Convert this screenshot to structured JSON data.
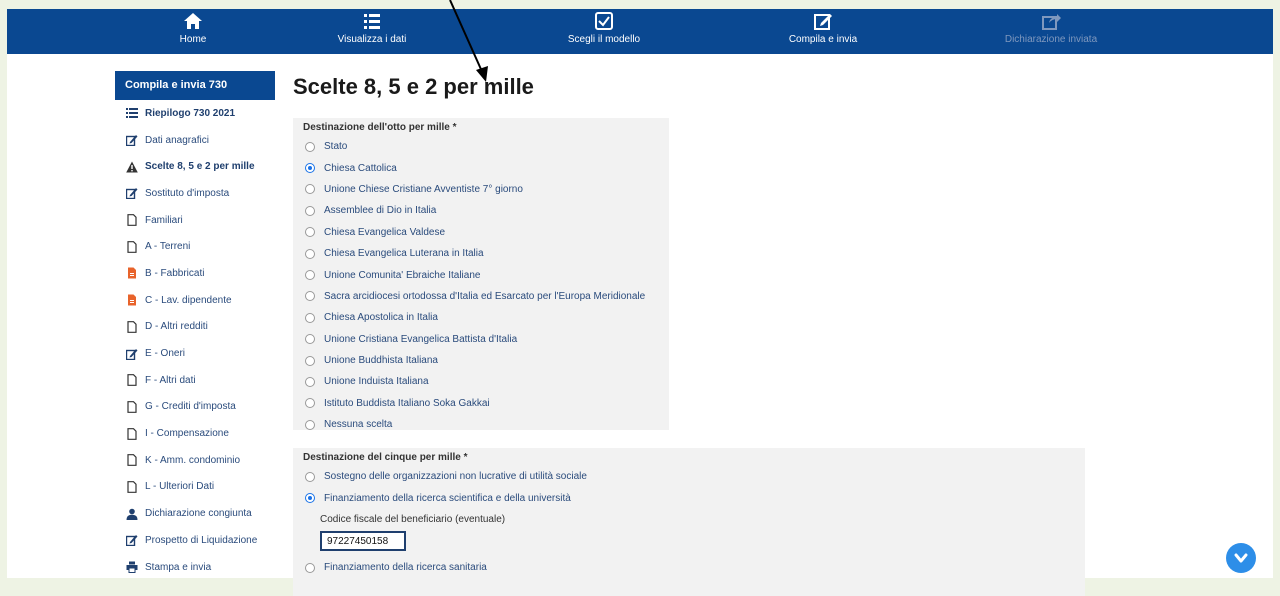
{
  "nav": {
    "items": [
      {
        "label": "Home",
        "icon": "home-icon"
      },
      {
        "label": "Visualizza i dati",
        "icon": "list-icon"
      },
      {
        "label": "Scegli il modello",
        "icon": "checkbox-icon"
      },
      {
        "label": "Compila e invia",
        "icon": "edit-icon"
      },
      {
        "label": "Dichiarazione inviata",
        "icon": "share-icon"
      }
    ]
  },
  "sidebar": {
    "header": "Compila e invia 730",
    "items": [
      {
        "label": "Riepilogo 730 2021",
        "icon": "list-icon"
      },
      {
        "label": "Dati anagrafici",
        "icon": "edit-icon"
      },
      {
        "label": "Scelte 8, 5 e 2 per mille",
        "icon": "warning-icon"
      },
      {
        "label": "Sostituto d'imposta",
        "icon": "edit-icon"
      },
      {
        "label": "Familiari",
        "icon": "file-icon"
      },
      {
        "label": "A - Terreni",
        "icon": "file-icon"
      },
      {
        "label": "B - Fabbricati",
        "icon": "file-orange-icon"
      },
      {
        "label": "C - Lav. dipendente",
        "icon": "file-orange-icon"
      },
      {
        "label": "D - Altri redditi",
        "icon": "file-icon"
      },
      {
        "label": "E - Oneri",
        "icon": "edit-icon"
      },
      {
        "label": "F - Altri dati",
        "icon": "file-icon"
      },
      {
        "label": "G - Crediti d'imposta",
        "icon": "file-icon"
      },
      {
        "label": "I - Compensazione",
        "icon": "file-icon"
      },
      {
        "label": "K - Amm. condominio",
        "icon": "file-icon"
      },
      {
        "label": "L - Ulteriori Dati",
        "icon": "file-icon"
      },
      {
        "label": "Dichiarazione congiunta",
        "icon": "user-icon"
      },
      {
        "label": "Prospetto di Liquidazione",
        "icon": "edit-icon"
      },
      {
        "label": "Stampa e invia",
        "icon": "print-icon"
      }
    ]
  },
  "main": {
    "title": "Scelte 8, 5 e 2 per mille",
    "otto": {
      "legend": "Destinazione dell'otto per mille *",
      "selected": "Chiesa Cattolica",
      "options": [
        "Stato",
        "Chiesa Cattolica",
        "Unione Chiese Cristiane Avventiste 7° giorno",
        "Assemblee di Dio in Italia",
        "Chiesa Evangelica Valdese",
        "Chiesa Evangelica Luterana in Italia",
        "Unione Comunita' Ebraiche Italiane",
        "Sacra arcidiocesi ortodossa d'Italia ed Esarcato per l'Europa Meridionale",
        "Chiesa Apostolica in Italia",
        "Unione Cristiana Evangelica Battista d'Italia",
        "Unione Buddhista Italiana",
        "Unione Induista Italiana",
        "Istituto Buddista Italiano Soka Gakkai",
        "Nessuna scelta"
      ]
    },
    "cinque": {
      "legend": "Destinazione del cinque per mille *",
      "options": [
        "Sostegno delle organizzazioni non lucrative di utilità sociale",
        "Finanziamento della ricerca scientifica e della università",
        "Finanziamento della ricerca sanitaria"
      ],
      "selected": "Finanziamento della ricerca scientifica e della università",
      "cf_label": "Codice fiscale del beneficiario (eventuale)",
      "cf_value": "97227450158"
    }
  },
  "colors": {
    "nav_bg": "#0a4891",
    "accent": "#1a73e8",
    "frame": "#eef3e4"
  }
}
